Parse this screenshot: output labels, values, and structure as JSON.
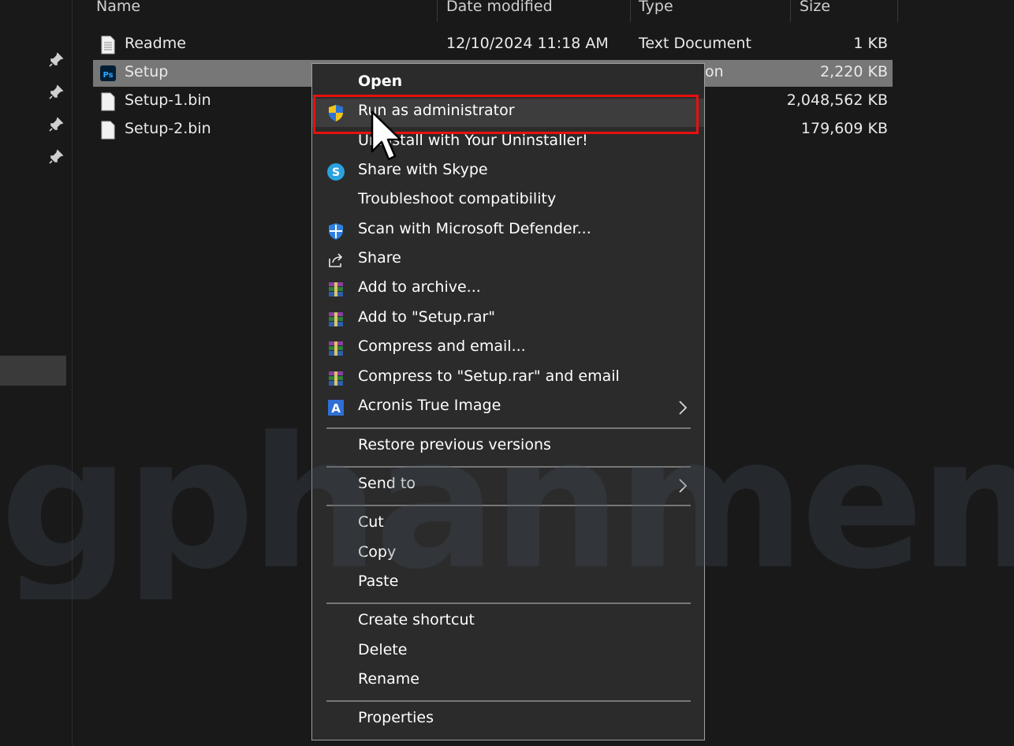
{
  "columns": {
    "name": "Name",
    "date_modified": "Date modified",
    "type": "Type",
    "size": "Size"
  },
  "files": [
    {
      "name": "Readme",
      "date": "12/10/2024 11:18 AM",
      "type": "Text Document",
      "size": "1 KB",
      "icon": "text-file-icon"
    },
    {
      "name": "Setup",
      "date": "",
      "type": "on",
      "size": "2,220 KB",
      "icon": "photoshop-icon",
      "selected": true
    },
    {
      "name": "Setup-1.bin",
      "date": "",
      "type": "",
      "size": "2,048,562 KB",
      "icon": "file-icon"
    },
    {
      "name": "Setup-2.bin",
      "date": "",
      "type": "",
      "size": "179,609 KB",
      "icon": "file-icon"
    }
  ],
  "context_menu": {
    "open": "Open",
    "run_as_admin": "Run as administrator",
    "uninstall": "Uninstall with Your Uninstaller!",
    "skype": "Share with Skype",
    "troubleshoot": "Troubleshoot compatibility",
    "defender": "Scan with Microsoft Defender...",
    "share": "Share",
    "add_archive": "Add to archive...",
    "add_rar": "Add to \"Setup.rar\"",
    "compress_email": "Compress and email...",
    "compress_rar_email": "Compress to \"Setup.rar\" and email",
    "acronis": "Acronis True Image",
    "restore": "Restore previous versions",
    "send_to": "Send to",
    "cut": "Cut",
    "copy": "Copy",
    "paste": "Paste",
    "create_shortcut": "Create shortcut",
    "delete": "Delete",
    "rename": "Rename",
    "properties": "Properties"
  },
  "watermark": "gphanmem.co",
  "colors": {
    "background": "#191919",
    "menu_bg": "#2b2b2b",
    "selected_row": "#777777",
    "highlight_box": "#e81010"
  }
}
